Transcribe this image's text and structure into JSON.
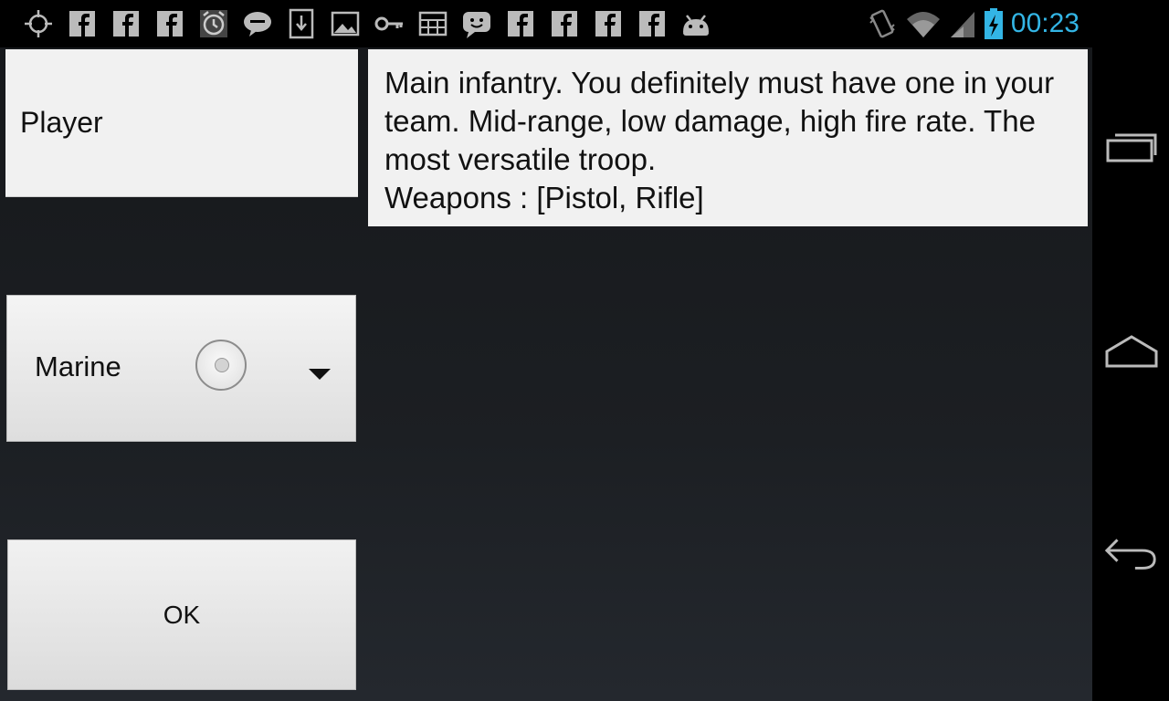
{
  "status_bar": {
    "notification_icons": [
      "gps-icon",
      "facebook-icon",
      "facebook-icon",
      "facebook-icon",
      "alarm-icon",
      "chat-icon",
      "download-icon",
      "image-icon",
      "key-icon",
      "grid-icon",
      "chat-face-icon",
      "facebook-icon",
      "facebook-icon",
      "facebook-icon",
      "facebook-icon",
      "android-icon"
    ],
    "system_icons": [
      "vibrate-icon",
      "wifi-icon",
      "signal-icon",
      "battery-charging-icon"
    ],
    "time": "00:23",
    "clock_color": "#33b5e5"
  },
  "form": {
    "player_value": "Player",
    "description_lines": [
      "Main infantry. You definitely must have one in your team. Mid-range, low damage, high fire rate. The most versatile troop.",
      "Weapons : [Pistol, Rifle]"
    ],
    "unit_spinner": {
      "selected": "Marine"
    },
    "ok_label": "OK"
  },
  "nav_bar": {
    "buttons": [
      "recent-apps-icon",
      "home-icon",
      "back-icon"
    ]
  }
}
